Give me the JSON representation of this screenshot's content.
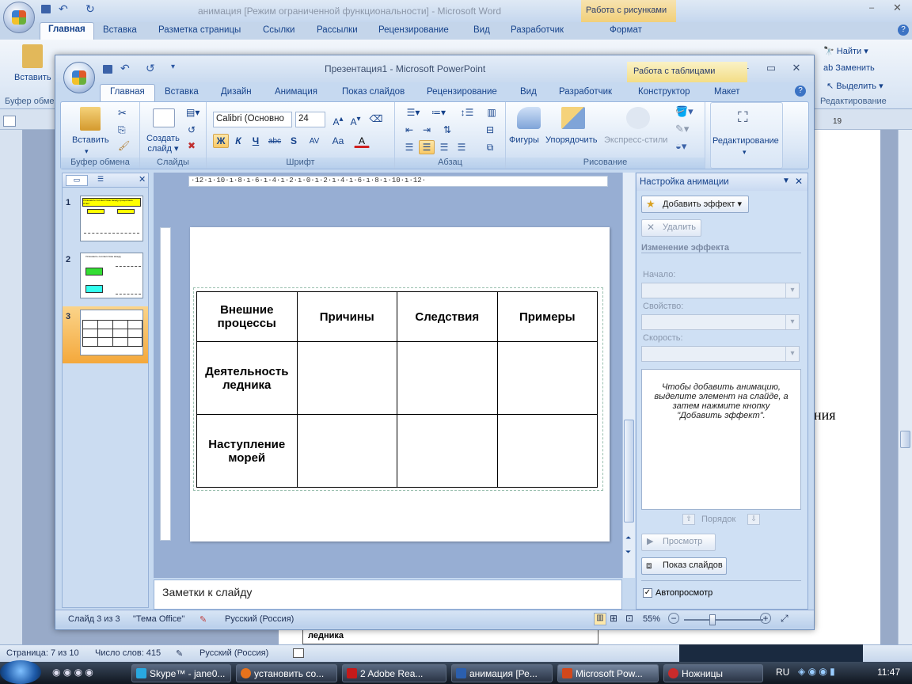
{
  "word": {
    "title": "анимация [Режим ограниченной функциональности] - Microsoft Word",
    "context_tab": "Работа с рисунками",
    "tabs": [
      "Главная",
      "Вставка",
      "Разметка страницы",
      "Ссылки",
      "Рассылки",
      "Рецензирование",
      "Вид",
      "Разработчик",
      "Формат"
    ],
    "ribbon": {
      "paste": "Вставить",
      "clipboard": "Буфер обме",
      "find": "Найти",
      "replace": "Заменить",
      "select": "Выделить",
      "editing": "Редактирование"
    },
    "ruler_mark": "19",
    "page_text": "ния",
    "cell_text": "ледника",
    "status": {
      "page": "Страница: 7 из 10",
      "words": "Число слов: 415",
      "lang": "Русский (Россия)"
    }
  },
  "ppt": {
    "title": "Презентация1 - Microsoft PowerPoint",
    "context_tab": "Работа с таблицами",
    "tabs": [
      "Главная",
      "Вставка",
      "Дизайн",
      "Анимация",
      "Показ слайдов",
      "Рецензирование",
      "Вид",
      "Разработчик",
      "Конструктор",
      "Макет"
    ],
    "ribbon": {
      "paste": "Вставить",
      "clipboard_group": "Буфер обмена",
      "new_slide_1": "Создать",
      "new_slide_2": "слайд",
      "slides_group": "Слайды",
      "font_name": "Calibri (Основно",
      "font_size": "24",
      "font_group": "Шрифт",
      "paragraph_group": "Абзац",
      "shapes": "Фигуры",
      "arrange": "Упорядочить",
      "quick_styles": "Экспресс-стили",
      "drawing_group": "Рисование",
      "editing": "Редактирование",
      "bold": "Ж",
      "italic": "К",
      "underline": "Ч",
      "strike": "abc",
      "shadow": "S",
      "spacing": "AV",
      "case": "Aa",
      "color": "A"
    },
    "ruler_text": "·12·ı·10·ı·8·ı·6·ı·4·ı·2·ı·0·ı·2·ı·4·ı·6·ı·8·ı·10·ı·12·",
    "slides": [
      {
        "num": "1",
        "header": "Установить соответствие между процессами. Ответ"
      },
      {
        "num": "2",
        "header": "Установить соответствие между"
      },
      {
        "num": "3",
        "header": ""
      }
    ],
    "table": {
      "rows": [
        [
          "Внешние процессы",
          "Причины",
          "Следствия",
          "Примеры"
        ],
        [
          "Деятельность ледника",
          "",
          "",
          ""
        ],
        [
          "Наступление морей",
          "",
          "",
          ""
        ]
      ]
    },
    "notes": "Заметки к слайду",
    "task_pane": {
      "title": "Настройка анимации",
      "add_effect": "Добавить эффект",
      "remove": "Удалить",
      "change_effect": "Изменение эффекта",
      "start_label": "Начало:",
      "property_label": "Свойство:",
      "speed_label": "Скорость:",
      "hint": "Чтобы добавить анимацию, выделите элемент на слайде, а затем нажмите кнопку \"Добавить эффект\".",
      "order": "Порядок",
      "preview": "Просмотр",
      "slideshow": "Показ слайдов",
      "autopreview": "Автопросмотр",
      "autopreview_checked": true
    },
    "status": {
      "slide": "Слайд 3 из 3",
      "theme": "\"Тема Office\"",
      "lang": "Русский (Россия)",
      "zoom": "55%",
      "zoom_level": 0.35
    }
  },
  "taskbar": {
    "items": [
      "Skype™ - jane0...",
      "установить со...",
      "2 Adobe Rea...",
      "анимация [Ре...",
      "Microsoft Pow...",
      "Ножницы"
    ],
    "lang": "RU",
    "time": "11:47"
  },
  "colors": {
    "accent": "#15428b",
    "ribbon_blue": "#c6d9f0",
    "context_tab": "#f3dd86",
    "active_slide": "#f6b44b"
  }
}
